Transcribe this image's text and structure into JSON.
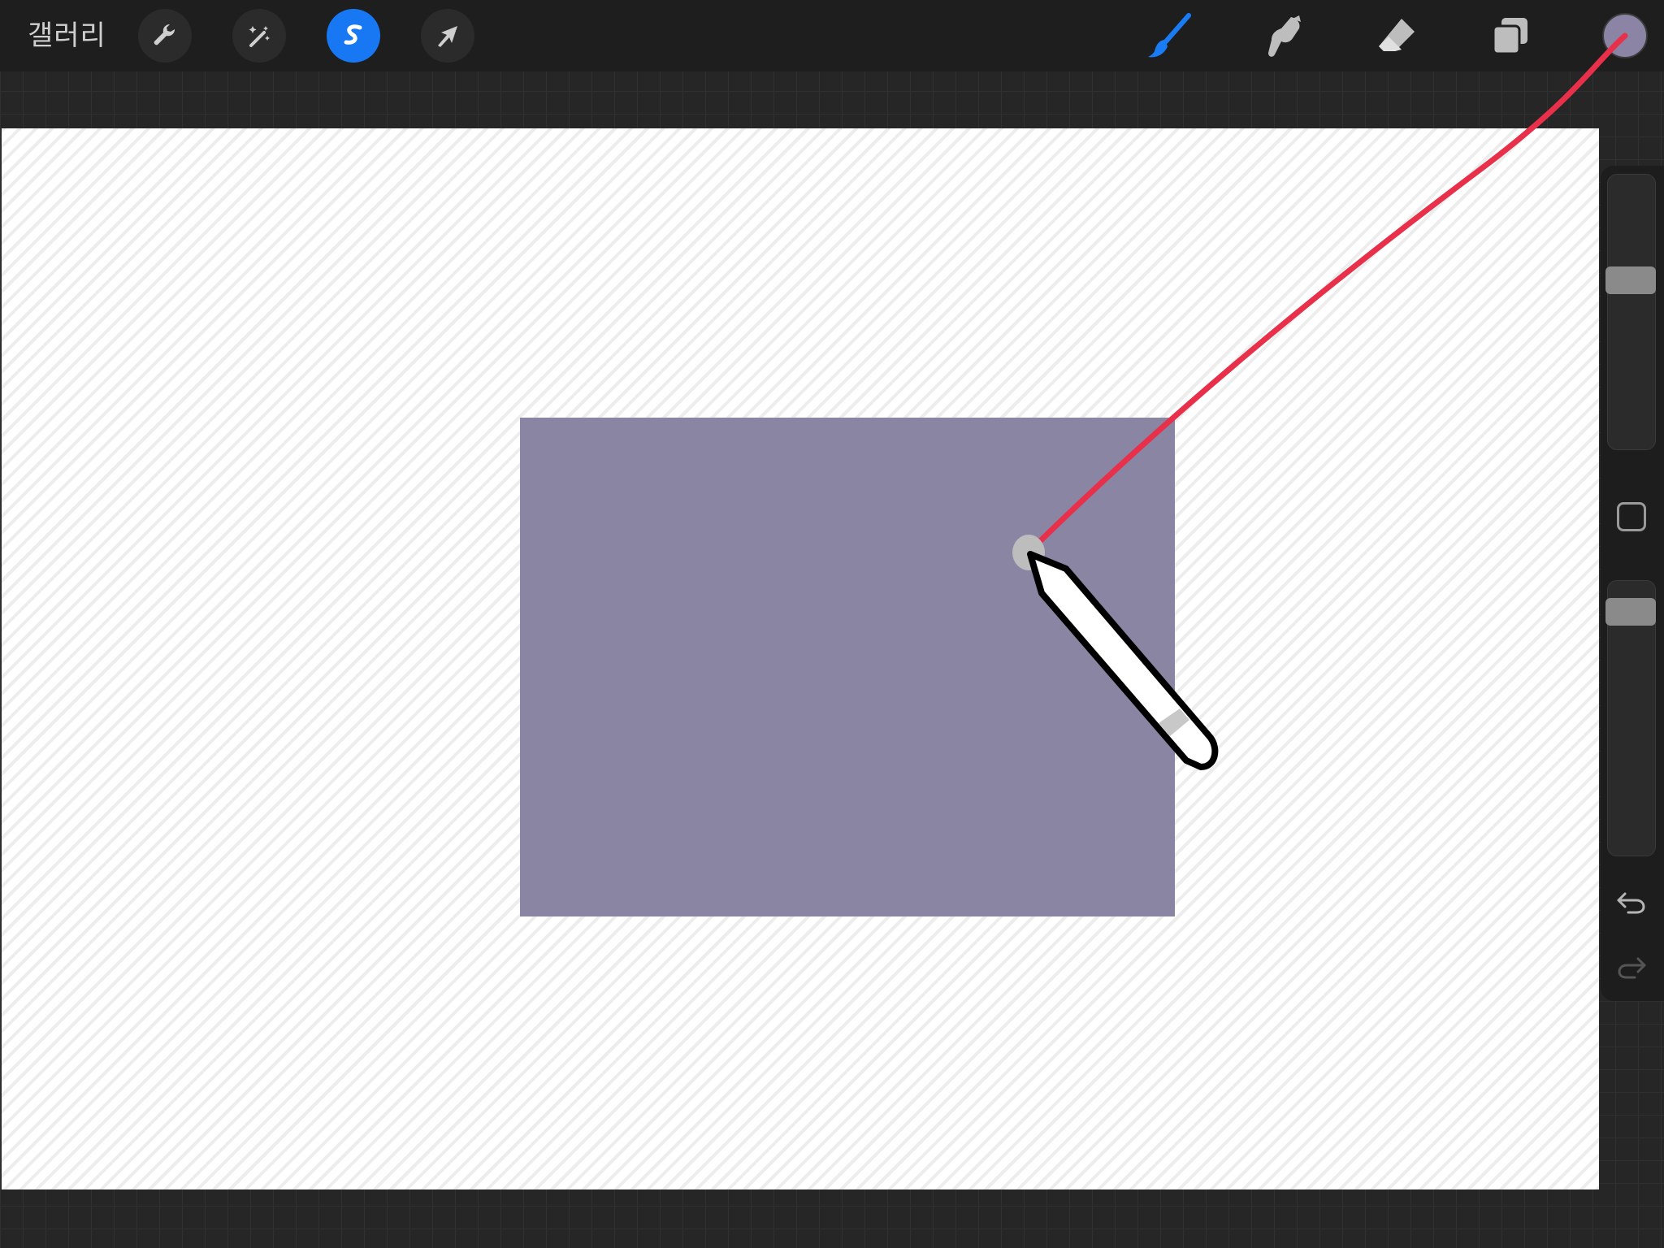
{
  "topbar": {
    "gallery_label": "갤러리",
    "left_tools": [
      {
        "name": "actions",
        "icon": "wrench-icon",
        "active": false
      },
      {
        "name": "adjustments",
        "icon": "magic-wand-icon",
        "active": false
      },
      {
        "name": "selection",
        "icon": "selection-s-icon",
        "active": true
      },
      {
        "name": "transform",
        "icon": "arrow-cursor-icon",
        "active": false
      }
    ],
    "right_tools": [
      {
        "name": "brush",
        "icon": "brush-icon",
        "active": true
      },
      {
        "name": "smudge",
        "icon": "smudge-icon",
        "active": false
      },
      {
        "name": "eraser",
        "icon": "eraser-icon",
        "active": false
      },
      {
        "name": "layers",
        "icon": "layers-icon",
        "active": false
      }
    ],
    "current_color": "#8b84a4"
  },
  "canvas": {
    "rect_fill": "#8985a2"
  },
  "sidebar": {
    "brush_size_level": 0.63,
    "opacity_level": 0.93
  },
  "annotation": {
    "line_color": "#e8304a",
    "pencil_icon": "apple-pencil-icon"
  },
  "colors": {
    "accent_blue": "#1877f2",
    "toolbar_bg": "#1e1e1e",
    "brush_icon_blue": "#1a7cf5"
  }
}
